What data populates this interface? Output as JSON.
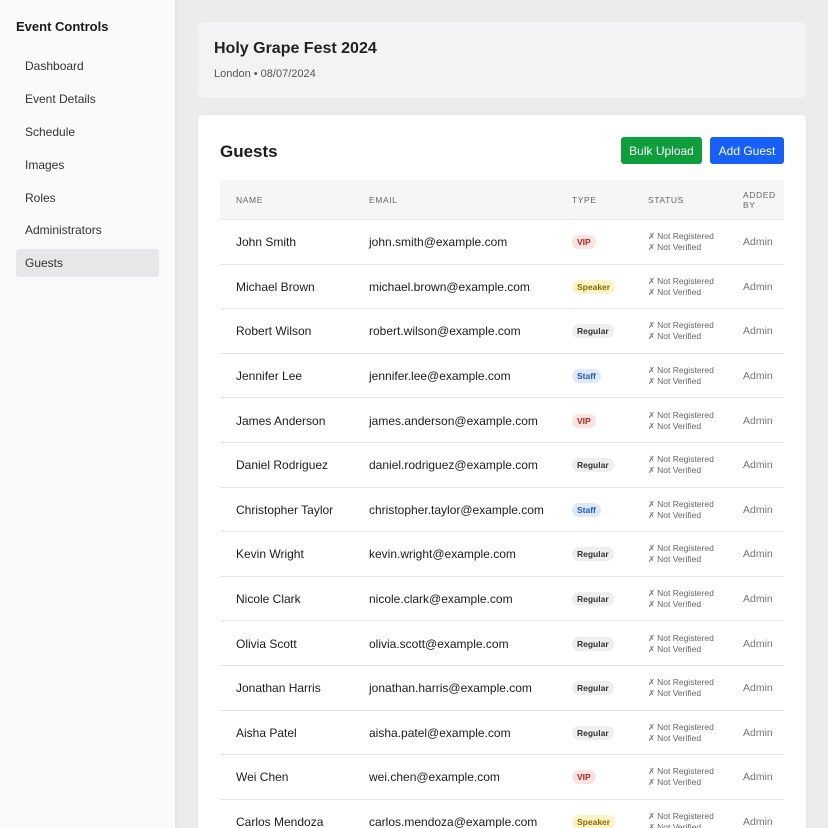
{
  "sidebar": {
    "title": "Event Controls",
    "items": [
      {
        "label": "Dashboard",
        "active": false
      },
      {
        "label": "Event Details",
        "active": false
      },
      {
        "label": "Schedule",
        "active": false
      },
      {
        "label": "Images",
        "active": false
      },
      {
        "label": "Roles",
        "active": false
      },
      {
        "label": "Administrators",
        "active": false
      },
      {
        "label": "Guests",
        "active": true
      }
    ]
  },
  "event": {
    "title": "Holy Grape Fest 2024",
    "subtitle": "London • 08/07/2024"
  },
  "guests": {
    "title": "Guests",
    "bulk_upload_label": "Bulk Upload",
    "add_guest_label": "Add Guest",
    "columns": [
      "Name",
      "Email",
      "Type",
      "Status",
      "Added By"
    ],
    "type_styles": {
      "VIP": {
        "bg": "#fde2e0",
        "fg": "#b3261e"
      },
      "Speaker": {
        "bg": "#fdf3c4",
        "fg": "#8a6a00"
      },
      "Regular": {
        "bg": "#eeeeef",
        "fg": "#333333"
      },
      "Staff": {
        "bg": "#dfe9fd",
        "fg": "#1f56c7"
      }
    },
    "rows": [
      {
        "name": "John Smith",
        "email": "john.smith@example.com",
        "type": "VIP",
        "registered": "Not Registered",
        "verified": "Not Verified",
        "added_by": "Admin"
      },
      {
        "name": "Michael Brown",
        "email": "michael.brown@example.com",
        "type": "Speaker",
        "registered": "Not Registered",
        "verified": "Not Verified",
        "added_by": "Admin"
      },
      {
        "name": "Robert Wilson",
        "email": "robert.wilson@example.com",
        "type": "Regular",
        "registered": "Not Registered",
        "verified": "Not Verified",
        "added_by": "Admin"
      },
      {
        "name": "Jennifer Lee",
        "email": "jennifer.lee@example.com",
        "type": "Staff",
        "registered": "Not Registered",
        "verified": "Not Verified",
        "added_by": "Admin"
      },
      {
        "name": "James Anderson",
        "email": "james.anderson@example.com",
        "type": "VIP",
        "registered": "Not Registered",
        "verified": "Not Verified",
        "added_by": "Admin"
      },
      {
        "name": "Daniel Rodriguez",
        "email": "daniel.rodriguez@example.com",
        "type": "Regular",
        "registered": "Not Registered",
        "verified": "Not Verified",
        "added_by": "Admin"
      },
      {
        "name": "Christopher Taylor",
        "email": "christopher.taylor@example.com",
        "type": "Staff",
        "registered": "Not Registered",
        "verified": "Not Verified",
        "added_by": "Admin"
      },
      {
        "name": "Kevin Wright",
        "email": "kevin.wright@example.com",
        "type": "Regular",
        "registered": "Not Registered",
        "verified": "Not Verified",
        "added_by": "Admin"
      },
      {
        "name": "Nicole Clark",
        "email": "nicole.clark@example.com",
        "type": "Regular",
        "registered": "Not Registered",
        "verified": "Not Verified",
        "added_by": "Admin"
      },
      {
        "name": "Olivia Scott",
        "email": "olivia.scott@example.com",
        "type": "Regular",
        "registered": "Not Registered",
        "verified": "Not Verified",
        "added_by": "Admin"
      },
      {
        "name": "Jonathan Harris",
        "email": "jonathan.harris@example.com",
        "type": "Regular",
        "registered": "Not Registered",
        "verified": "Not Verified",
        "added_by": "Admin"
      },
      {
        "name": "Aisha Patel",
        "email": "aisha.patel@example.com",
        "type": "Regular",
        "registered": "Not Registered",
        "verified": "Not Verified",
        "added_by": "Admin"
      },
      {
        "name": "Wei Chen",
        "email": "wei.chen@example.com",
        "type": "VIP",
        "registered": "Not Registered",
        "verified": "Not Verified",
        "added_by": "Admin"
      },
      {
        "name": "Carlos Mendoza",
        "email": "carlos.mendoza@example.com",
        "type": "Speaker",
        "registered": "Not Registered",
        "verified": "Not Verified",
        "added_by": "Admin"
      }
    ]
  }
}
